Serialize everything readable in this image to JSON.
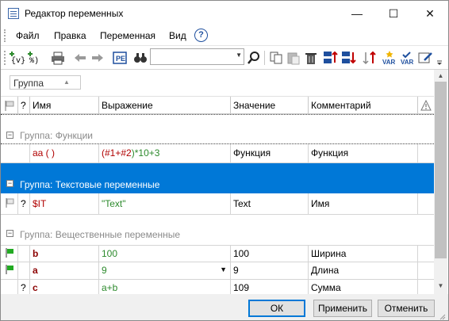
{
  "window": {
    "title": "Редактор переменных",
    "minimize": "—",
    "maximize": "☐",
    "close": "✕"
  },
  "menu": [
    {
      "label": "Файл"
    },
    {
      "label": "Правка"
    },
    {
      "label": "Переменная"
    },
    {
      "label": "Вид"
    }
  ],
  "help_icon": "?",
  "toolbar": {
    "search_value": ""
  },
  "group_dropdown": {
    "label": "Группа"
  },
  "columns": {
    "flag": "",
    "q": "?",
    "name": "Имя",
    "expr": "Выражение",
    "value": "Значение",
    "comment": "Комментарий"
  },
  "groups": [
    {
      "label": "Группа: Функции",
      "toggle": "−"
    },
    {
      "label": "Группа: Текстовые переменные",
      "toggle": "−"
    },
    {
      "label": "Группа: Вещественные переменные",
      "toggle": "−"
    }
  ],
  "rows": {
    "func": {
      "name": "aa ( )",
      "expr_p1": "(",
      "expr_a1": "#1",
      "expr_p2": "+",
      "expr_a2": "#2",
      "expr_p3": ")*10+3",
      "value": "Функция",
      "comment": "Функция"
    },
    "text": {
      "q": "?",
      "name": "$IT",
      "expr": "\"Text\"",
      "value": "Text",
      "comment": "Имя"
    },
    "real": [
      {
        "q": "",
        "name": "b",
        "expr": "100",
        "value": "100",
        "comment": "Ширина"
      },
      {
        "q": "",
        "name": "a",
        "expr": "9",
        "value": "9",
        "comment": "Длина"
      },
      {
        "q": "?",
        "name": "c",
        "expr": "a+b",
        "value": "109",
        "comment": "Сумма"
      }
    ]
  },
  "buttons": {
    "ok": "ОК",
    "apply": "Применить",
    "cancel": "Отменить"
  }
}
